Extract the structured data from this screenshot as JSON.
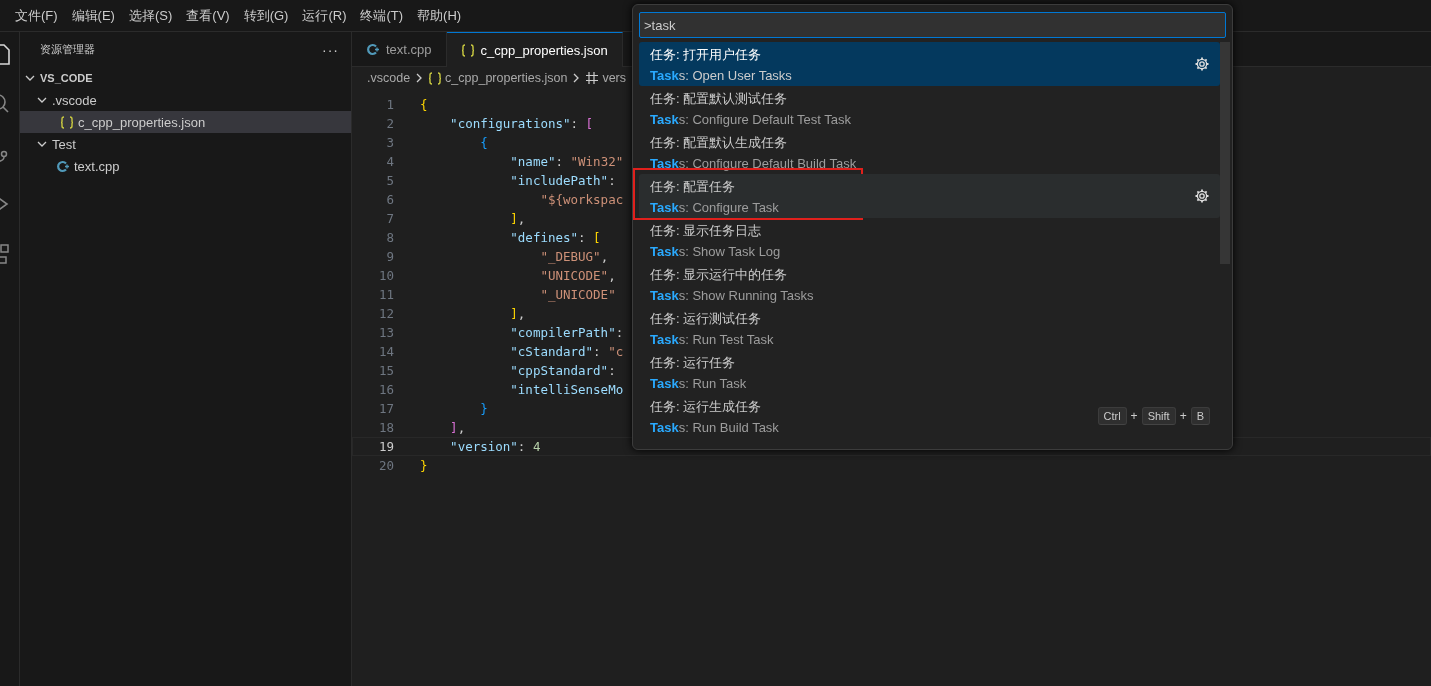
{
  "menu_bar": {
    "items": [
      "文件(F)",
      "编辑(E)",
      "选择(S)",
      "查看(V)",
      "转到(G)",
      "运行(R)",
      "终端(T)",
      "帮助(H)"
    ]
  },
  "sidebar": {
    "title": "资源管理器",
    "more": "···",
    "tree": [
      {
        "label": "VS_CODE",
        "kind": "root",
        "expanded": true,
        "selected": false,
        "children": [
          {
            "label": ".vscode",
            "kind": "folder",
            "expanded": true,
            "selected": false,
            "children": [
              {
                "label": "c_cpp_properties.json",
                "kind": "json",
                "selected": true
              }
            ]
          },
          {
            "label": "Test",
            "kind": "folder",
            "expanded": true,
            "selected": false,
            "children": [
              {
                "label": "text.cpp",
                "kind": "cpp",
                "selected": false
              }
            ]
          }
        ]
      }
    ]
  },
  "tabs": [
    {
      "label": "text.cpp",
      "kind": "cpp",
      "selected": false
    },
    {
      "label": "c_cpp_properties.json",
      "kind": "json",
      "selected": true
    }
  ],
  "breadcrumb": [
    {
      "label": ".vscode",
      "kind": "folder"
    },
    {
      "label": "c_cpp_properties.json",
      "kind": "json"
    },
    {
      "label": "vers",
      "kind": "number"
    }
  ],
  "editor": {
    "lines": [
      {
        "number": "1",
        "current": false,
        "tokens": [
          {
            "t": "{",
            "kind": "b1"
          }
        ]
      },
      {
        "number": "2",
        "current": false,
        "tokens": [
          {
            "t": "    \"configurations\"",
            "kind": "key"
          },
          {
            "t": ": ",
            "kind": "punct"
          },
          {
            "t": "[",
            "kind": "b2"
          }
        ]
      },
      {
        "number": "3",
        "current": false,
        "tokens": [
          {
            "t": "        {",
            "kind": "b3"
          }
        ]
      },
      {
        "number": "4",
        "current": false,
        "tokens": [
          {
            "t": "            \"name\"",
            "kind": "key"
          },
          {
            "t": ": ",
            "kind": "punct"
          },
          {
            "t": "\"Win32\"",
            "kind": "str"
          }
        ]
      },
      {
        "number": "5",
        "current": false,
        "tokens": [
          {
            "t": "            \"includePath\"",
            "kind": "key"
          },
          {
            "t": ":",
            "kind": "punct"
          }
        ]
      },
      {
        "number": "6",
        "current": false,
        "tokens": [
          {
            "t": "                \"${workspac",
            "kind": "str"
          }
        ]
      },
      {
        "number": "7",
        "current": false,
        "tokens": [
          {
            "t": "            ]",
            "kind": "b1"
          },
          {
            "t": ",",
            "kind": "punct"
          }
        ]
      },
      {
        "number": "8",
        "current": false,
        "tokens": [
          {
            "t": "            \"defines\"",
            "kind": "key"
          },
          {
            "t": ": ",
            "kind": "punct"
          },
          {
            "t": "[",
            "kind": "b1"
          }
        ]
      },
      {
        "number": "9",
        "current": false,
        "tokens": [
          {
            "t": "                \"_DEBUG\"",
            "kind": "str"
          },
          {
            "t": ",",
            "kind": "punct"
          }
        ]
      },
      {
        "number": "10",
        "current": false,
        "tokens": [
          {
            "t": "                \"UNICODE\"",
            "kind": "str"
          },
          {
            "t": ",",
            "kind": "punct"
          }
        ]
      },
      {
        "number": "11",
        "current": false,
        "tokens": [
          {
            "t": "                \"_UNICODE\"",
            "kind": "str"
          }
        ]
      },
      {
        "number": "12",
        "current": false,
        "tokens": [
          {
            "t": "            ]",
            "kind": "b1"
          },
          {
            "t": ",",
            "kind": "punct"
          }
        ]
      },
      {
        "number": "13",
        "current": false,
        "tokens": [
          {
            "t": "            \"compilerPath\"",
            "kind": "key"
          },
          {
            "t": ":",
            "kind": "punct"
          }
        ]
      },
      {
        "number": "14",
        "current": false,
        "tokens": [
          {
            "t": "            \"cStandard\"",
            "kind": "key"
          },
          {
            "t": ": ",
            "kind": "punct"
          },
          {
            "t": "\"c",
            "kind": "str"
          }
        ]
      },
      {
        "number": "15",
        "current": false,
        "tokens": [
          {
            "t": "            \"cppStandard\"",
            "kind": "key"
          },
          {
            "t": ":",
            "kind": "punct"
          }
        ]
      },
      {
        "number": "16",
        "current": false,
        "tokens": [
          {
            "t": "            \"intelliSenseMo",
            "kind": "key"
          }
        ]
      },
      {
        "number": "17",
        "current": false,
        "tokens": [
          {
            "t": "        }",
            "kind": "b3"
          }
        ]
      },
      {
        "number": "18",
        "current": false,
        "tokens": [
          {
            "t": "    ]",
            "kind": "b2"
          },
          {
            "t": ",",
            "kind": "punct"
          }
        ]
      },
      {
        "number": "19",
        "current": true,
        "tokens": [
          {
            "t": "    \"version\"",
            "kind": "key"
          },
          {
            "t": ": ",
            "kind": "punct"
          },
          {
            "t": "4",
            "kind": "num"
          }
        ]
      },
      {
        "number": "20",
        "current": false,
        "tokens": [
          {
            "t": "}",
            "kind": "b1"
          }
        ]
      }
    ]
  },
  "quick_pick": {
    "value": ">task",
    "items": [
      {
        "label": "任务: 打开用户任务",
        "detail": "**Task**s: Open User Tasks",
        "selected": true,
        "hovered": false,
        "gear": true,
        "annotated": false
      },
      {
        "label": "任务: 配置默认测试任务",
        "detail": "**Task**s: Configure Default Test Task",
        "selected": false,
        "hovered": false,
        "gear": false,
        "annotated": false
      },
      {
        "label": "任务: 配置默认生成任务",
        "detail": "**Task**s: Configure Default Build Task",
        "selected": false,
        "hovered": false,
        "gear": false,
        "annotated": false
      },
      {
        "label": "任务: 配置任务",
        "detail": "**Task**s: Configure Task",
        "selected": false,
        "hovered": true,
        "gear": true,
        "annotated": true
      },
      {
        "label": "任务: 显示任务日志",
        "detail": "**Task**s: Show Task Log",
        "selected": false,
        "hovered": false,
        "gear": false,
        "annotated": false
      },
      {
        "label": "任务: 显示运行中的任务",
        "detail": "**Task**s: Show Running Tasks",
        "selected": false,
        "hovered": false,
        "gear": false,
        "annotated": false
      },
      {
        "label": "任务: 运行测试任务",
        "detail": "**Task**s: Run Test Task",
        "selected": false,
        "hovered": false,
        "gear": false,
        "annotated": false
      },
      {
        "label": "任务: 运行任务",
        "detail": "**Task**s: Run Task",
        "selected": false,
        "hovered": false,
        "gear": false,
        "annotated": false
      },
      {
        "label": "任务: 运行生成任务",
        "detail": "**Task**s: Run Build Task",
        "selected": false,
        "hovered": false,
        "gear": false,
        "annotated": false,
        "keybinding": [
          {
            "t": "Ctrl",
            "kind": "key"
          },
          {
            "t": "+",
            "kind": "sep"
          },
          {
            "t": "Shift",
            "kind": "key"
          },
          {
            "t": "+",
            "kind": "sep"
          },
          {
            "t": "B",
            "kind": "key"
          }
        ]
      }
    ]
  }
}
